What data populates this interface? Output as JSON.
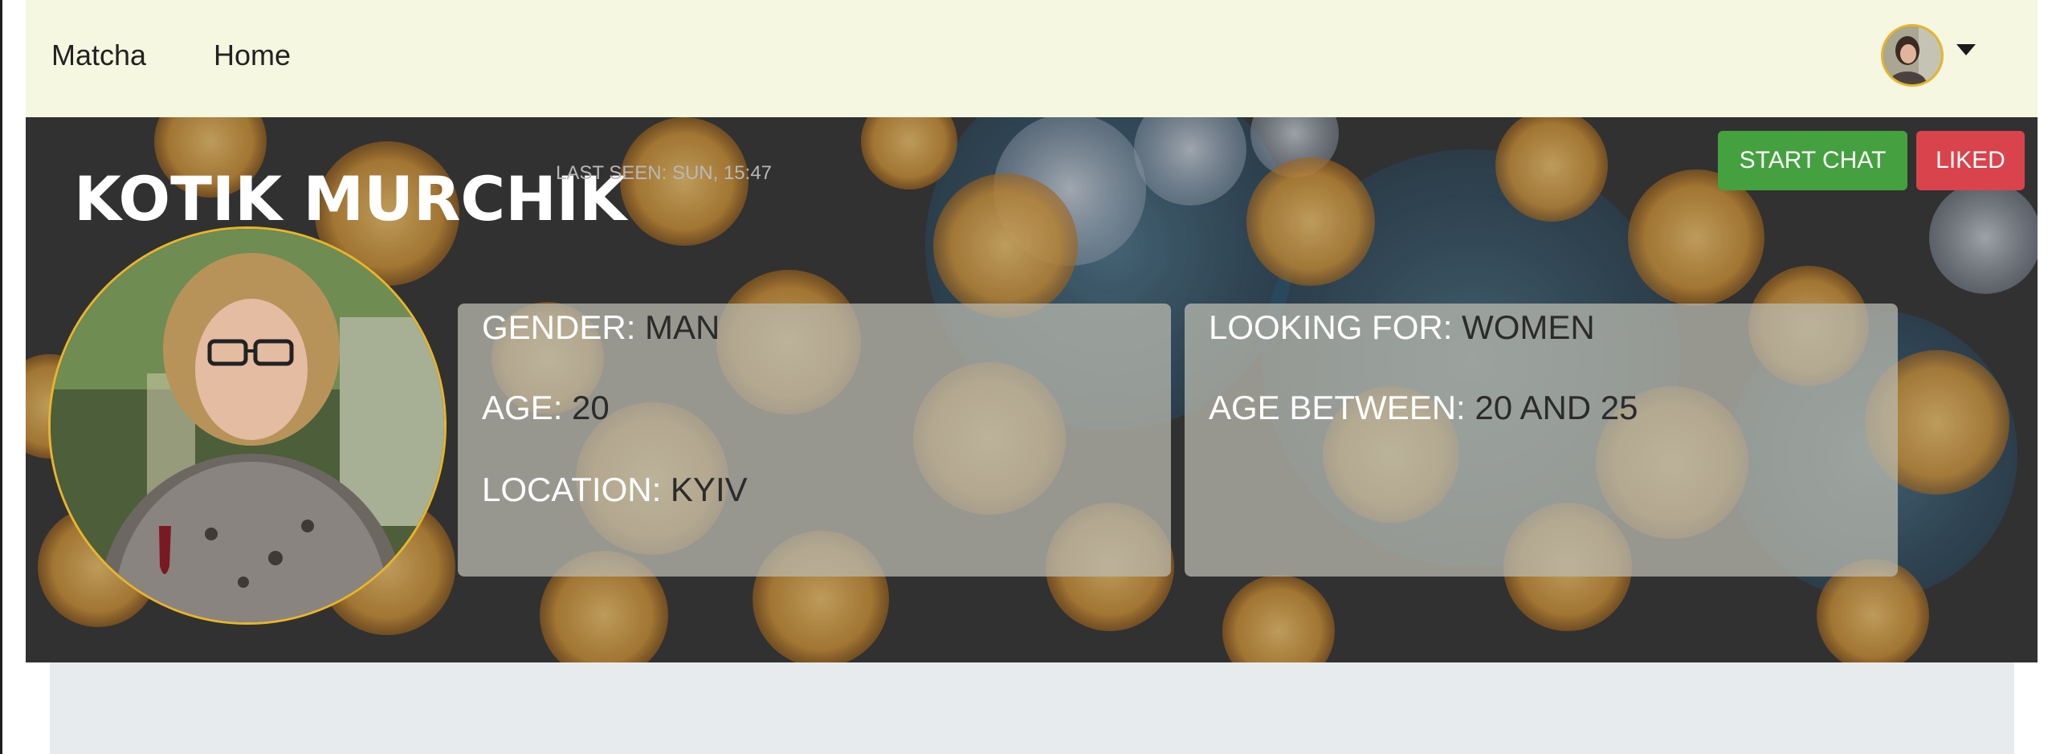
{
  "navbar": {
    "brand": "Matcha",
    "home_label": "Home",
    "avatar_icon": "user-avatar",
    "caret_icon": "caret-down-icon"
  },
  "profile": {
    "name": "KOTIK MURCHIK",
    "last_seen": "LAST SEEN: SUN, 15:47",
    "buttons": {
      "start_chat": "START CHAT",
      "liked": "LIKED"
    },
    "info": {
      "gender_label": "GENDER:",
      "gender_value": "MAN",
      "age_label": "AGE:",
      "age_value": "20",
      "location_label": "LOCATION:",
      "location_value": "KYIV"
    },
    "preferences": {
      "looking_for_label": "LOOKING FOR:",
      "looking_for_value": "WOMEN",
      "age_between_label": "AGE BETWEEN:",
      "age_between_value": "20 AND 25"
    }
  },
  "colors": {
    "navbar_bg": "#f5f7e0",
    "accent_border": "#e7b52d",
    "chat_button": "#45a13f",
    "liked_button": "#d9434c"
  }
}
